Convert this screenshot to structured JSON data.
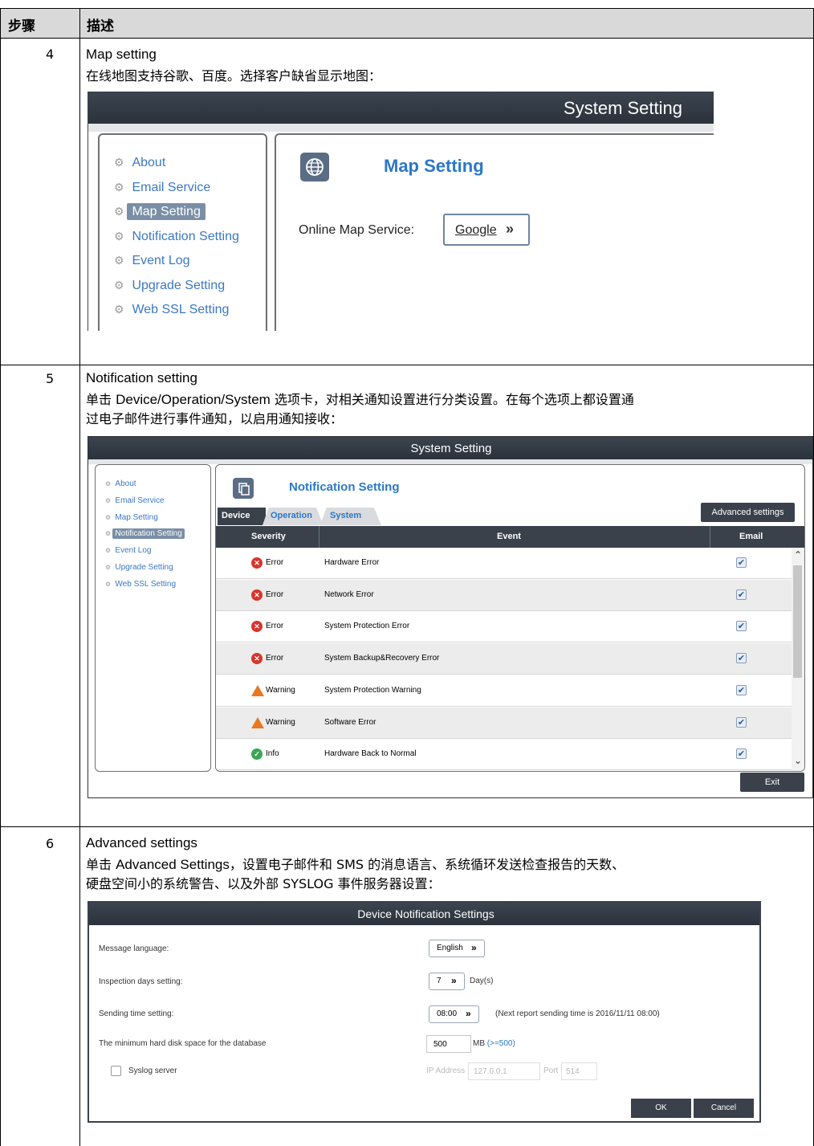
{
  "table": {
    "header_step": "步骤",
    "header_desc": "描述"
  },
  "rows": [
    {
      "step": "4",
      "title": "Map setting",
      "desc": "在线地图支持谷歌、百度。选择客户缺省显示地图："
    },
    {
      "step": "5",
      "title": "Notification setting",
      "desc_pre": "单击 ",
      "desc_bold": "Device/Operation/System",
      "desc_post1": " 选项卡，对相关通知设置进行分类设置。在每个选项上都设置通",
      "desc_line2": "过电子邮件进行事件通知，以启用通知接收："
    },
    {
      "step": "6",
      "title": "Advanced settings",
      "desc_pre": "单击 ",
      "desc_bold": "Advanced Settings",
      "desc_post1": "，设置电子邮件和 SMS 的消息语言、系统循环发送检查报告的天数、",
      "desc_line2": "硬盘空间小的系统警告、以及外部 SYSLOG 事件服务器设置："
    }
  ],
  "shot1": {
    "title": "System Setting",
    "nav": [
      "About",
      "Email Service",
      "Map Setting",
      "Notification Setting",
      "Event Log",
      "Upgrade Setting",
      "Web SSL Setting"
    ],
    "selected_index": 2,
    "heading": "Map Setting",
    "field_label": "Online Map Service:",
    "field_value": "Google",
    "icon": "globe-icon"
  },
  "shot2": {
    "title": "System Setting",
    "nav": [
      "About",
      "Email Service",
      "Map Setting",
      "Notification Setting",
      "Event Log",
      "Upgrade Setting",
      "Web SSL Setting"
    ],
    "selected_index": 3,
    "heading": "Notification Setting",
    "tabs": [
      "Device",
      "Operation",
      "System"
    ],
    "active_tab": 0,
    "advanced_button": "Advanced settings",
    "columns": [
      "Severity",
      "Event",
      "Email"
    ],
    "rows": [
      {
        "severity": "Error",
        "icon": "error-icon",
        "event": "Hardware Error",
        "email": true
      },
      {
        "severity": "Error",
        "icon": "error-icon",
        "event": "Network Error",
        "email": true
      },
      {
        "severity": "Error",
        "icon": "error-icon",
        "event": "System Protection Error",
        "email": true
      },
      {
        "severity": "Error",
        "icon": "error-icon",
        "event": "System Backup&Recovery Error",
        "email": true
      },
      {
        "severity": "Warning",
        "icon": "warning-icon",
        "event": "System Protection Warning",
        "email": true
      },
      {
        "severity": "Warning",
        "icon": "warning-icon",
        "event": "Software Error",
        "email": true
      },
      {
        "severity": "Info",
        "icon": "info-icon",
        "event": "Hardware Back to Normal",
        "email": true
      }
    ],
    "exit_button": "Exit"
  },
  "shot3": {
    "title": "Device Notification Settings",
    "language_label": "Message language:",
    "language_value": "English",
    "inspection_label": "Inspection days setting:",
    "inspection_value": "7",
    "inspection_unit": "Day(s)",
    "sending_label": "Sending time setting:",
    "sending_value": "08:00",
    "sending_note": "(Next report sending time is 2016/11/11 08:00)",
    "disk_label": "The minimum hard disk space for the database",
    "disk_value": "500",
    "disk_unit": "MB",
    "disk_hint": "(>=500)",
    "syslog_label": "Syslog server",
    "ip_label": "IP Address",
    "ip_value": "127.0.0.1",
    "port_label": "Port",
    "port_value": "514",
    "ok": "OK",
    "cancel": "Cancel"
  }
}
